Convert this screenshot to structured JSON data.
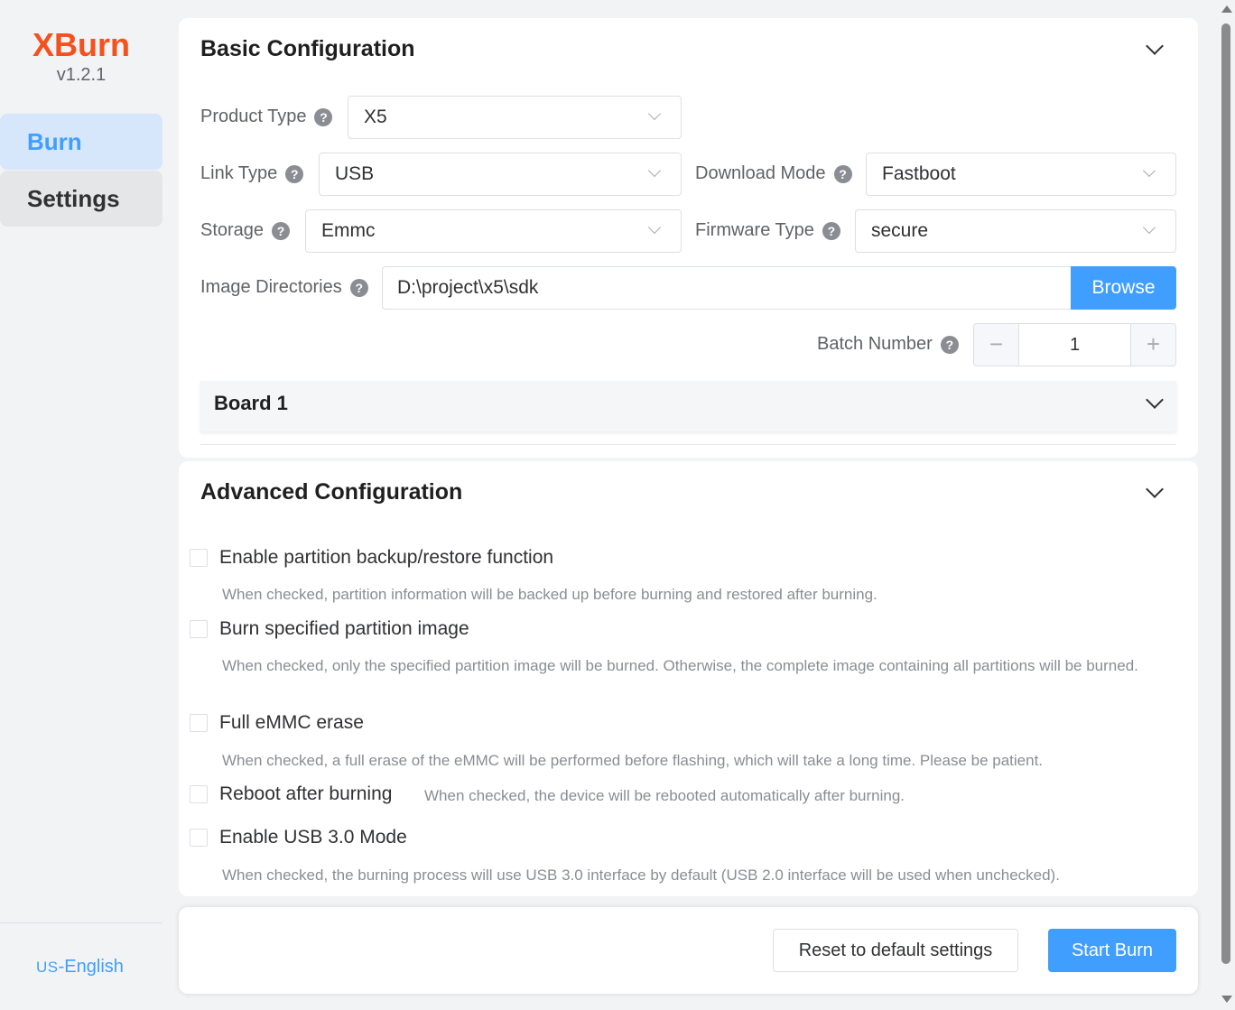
{
  "app": {
    "name": "XBurn",
    "version": "v1.2.1"
  },
  "sidebar": {
    "items": [
      {
        "label": "Burn",
        "active": true
      },
      {
        "label": "Settings",
        "active": false
      }
    ],
    "language": {
      "flag": "US",
      "separator": "-",
      "label": "English"
    }
  },
  "basic": {
    "title": "Basic Configuration",
    "product_type": {
      "label": "Product Type",
      "value": "X5"
    },
    "link_type": {
      "label": "Link Type",
      "value": "USB"
    },
    "download_mode": {
      "label": "Download Mode",
      "value": "Fastboot"
    },
    "storage": {
      "label": "Storage",
      "value": "Emmc"
    },
    "firmware_type": {
      "label": "Firmware Type",
      "value": "secure"
    },
    "image_dir": {
      "label": "Image Directories",
      "value": "D:\\project\\x5\\sdk",
      "browse_label": "Browse"
    },
    "batch": {
      "label": "Batch Number",
      "value": "1",
      "dec": "−",
      "inc": "+"
    },
    "board": {
      "title": "Board 1"
    },
    "help_glyph": "?"
  },
  "advanced": {
    "title": "Advanced Configuration",
    "options": [
      {
        "label": "Enable partition backup/restore function",
        "checked": false,
        "description": "When checked, partition information will be backed up before burning and restored after burning."
      },
      {
        "label": "Burn specified partition image",
        "checked": false,
        "description": "When checked, only the specified partition image will be burned. Otherwise, the complete image containing all partitions will be burned."
      },
      {
        "label": "Full eMMC erase",
        "checked": false,
        "description": "When checked, a full erase of the eMMC will be performed before flashing, which will take a long time. Please be patient."
      },
      {
        "label": "Reboot after burning",
        "checked": false,
        "description": "When checked, the device will be rebooted automatically after burning."
      },
      {
        "label": "Enable USB 3.0 Mode",
        "checked": false,
        "description": "When checked, the burning process will use USB 3.0 interface by default (USB 2.0 interface will be used when unchecked)."
      }
    ]
  },
  "footer": {
    "reset_label": "Reset to default settings",
    "start_label": "Start Burn"
  },
  "colors": {
    "accent": "#409eff",
    "brand": "#f4511e",
    "background": "#f2f3f5"
  }
}
